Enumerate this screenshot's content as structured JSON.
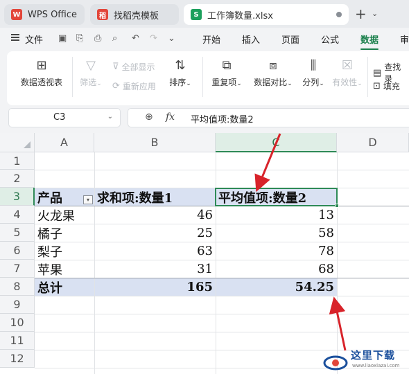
{
  "tabs": [
    {
      "label": "WPS Office",
      "logo": "W",
      "color": "#e2463a"
    },
    {
      "label": "找稻壳模板",
      "logo": "稻",
      "color": "#e2463a"
    },
    {
      "label": "工作簿数量.xlsx",
      "logo": "S",
      "color": "#1b9f5c"
    }
  ],
  "menu": {
    "file": "文件",
    "items": [
      "开始",
      "插入",
      "页面",
      "公式",
      "数据",
      "审"
    ],
    "active": "数据"
  },
  "ribbon": {
    "pivot": "数据透视表",
    "filter": "筛选",
    "show_all": "全部显示",
    "reapply": "重新应用",
    "sort": "排序",
    "duplicates": "重复项",
    "compare": "数据对比",
    "split": "分列",
    "validity": "有效性",
    "lookup": "查找录",
    "fill": "填充"
  },
  "formula_bar": {
    "cell_ref": "C3",
    "formula": "平均值项:数量2",
    "fx": "fx"
  },
  "columns": [
    "A",
    "B",
    "C",
    "D"
  ],
  "rows": [
    "1",
    "2",
    "3",
    "4",
    "5",
    "6",
    "7",
    "8",
    "9",
    "10",
    "11",
    "12"
  ],
  "pivot": {
    "header": [
      "产品",
      "求和项:数量1",
      "平均值项:数量2"
    ],
    "data": [
      [
        "火龙果",
        "46",
        "13"
      ],
      [
        "橘子",
        "25",
        "58"
      ],
      [
        "梨子",
        "63",
        "78"
      ],
      [
        "苹果",
        "31",
        "68"
      ]
    ],
    "total": [
      "总计",
      "165",
      "54.25"
    ]
  },
  "watermark": {
    "text": "这里下载",
    "url": "www.liaoxiazai.com"
  }
}
